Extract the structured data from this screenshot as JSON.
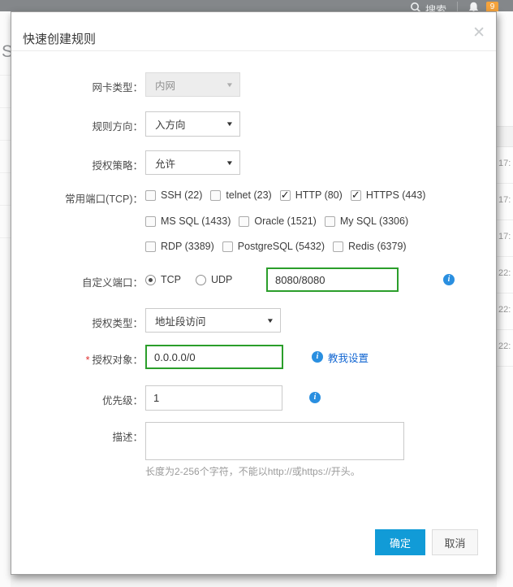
{
  "topbar": {
    "search_label": "搜索",
    "notification_count": "9"
  },
  "background": {
    "left_heading_fragment": "Se",
    "row_times": [
      "17:",
      "17:",
      "17:",
      "22:",
      "22:",
      "22:"
    ]
  },
  "icons": {
    "close": "✕",
    "caret": "▼",
    "info": "i"
  },
  "dialog": {
    "title": "快速创建规则",
    "fields": {
      "nic_type": {
        "label": "网卡类型：",
        "value": "内网"
      },
      "direction": {
        "label": "规则方向：",
        "value": "入方向"
      },
      "policy": {
        "label": "授权策略：",
        "value": "允许"
      },
      "common_ports": {
        "label": "常用端口(TCP)：",
        "rows": [
          [
            {
              "label": "SSH (22)",
              "checked": false
            },
            {
              "label": "telnet (23)",
              "checked": false
            },
            {
              "label": "HTTP (80)",
              "checked": true
            },
            {
              "label": "HTTPS (443)",
              "checked": true
            }
          ],
          [
            {
              "label": "MS SQL (1433)",
              "checked": false
            },
            {
              "label": "Oracle (1521)",
              "checked": false
            },
            {
              "label": "My SQL (3306)",
              "checked": false
            }
          ],
          [
            {
              "label": "RDP (3389)",
              "checked": false
            },
            {
              "label": "PostgreSQL (5432)",
              "checked": false
            },
            {
              "label": "Redis (6379)",
              "checked": false
            }
          ]
        ]
      },
      "custom_port": {
        "label": "自定义端口：",
        "protocols": [
          {
            "label": "TCP",
            "selected": true
          },
          {
            "label": "UDP",
            "selected": false
          }
        ],
        "value": "8080/8080"
      },
      "auth_type": {
        "label": "授权类型：",
        "value": "地址段访问"
      },
      "auth_object": {
        "label": "授权对象：",
        "required_mark": "*",
        "value": "0.0.0.0/0",
        "help_link": "教我设置"
      },
      "priority": {
        "label": "优先级：",
        "value": "1"
      },
      "description": {
        "label": "描述：",
        "value": "",
        "hint": "长度为2-256个字符，不能以http://或https://开头。"
      }
    },
    "footer": {
      "ok": "确定",
      "cancel": "取消"
    }
  },
  "colors": {
    "primary_button": "#119bd7",
    "valid_border": "#2b9e2b",
    "info_icon": "#2a8fe0",
    "link": "#1266d2",
    "badge": "#f5a33c",
    "topbar": "#84878a"
  }
}
